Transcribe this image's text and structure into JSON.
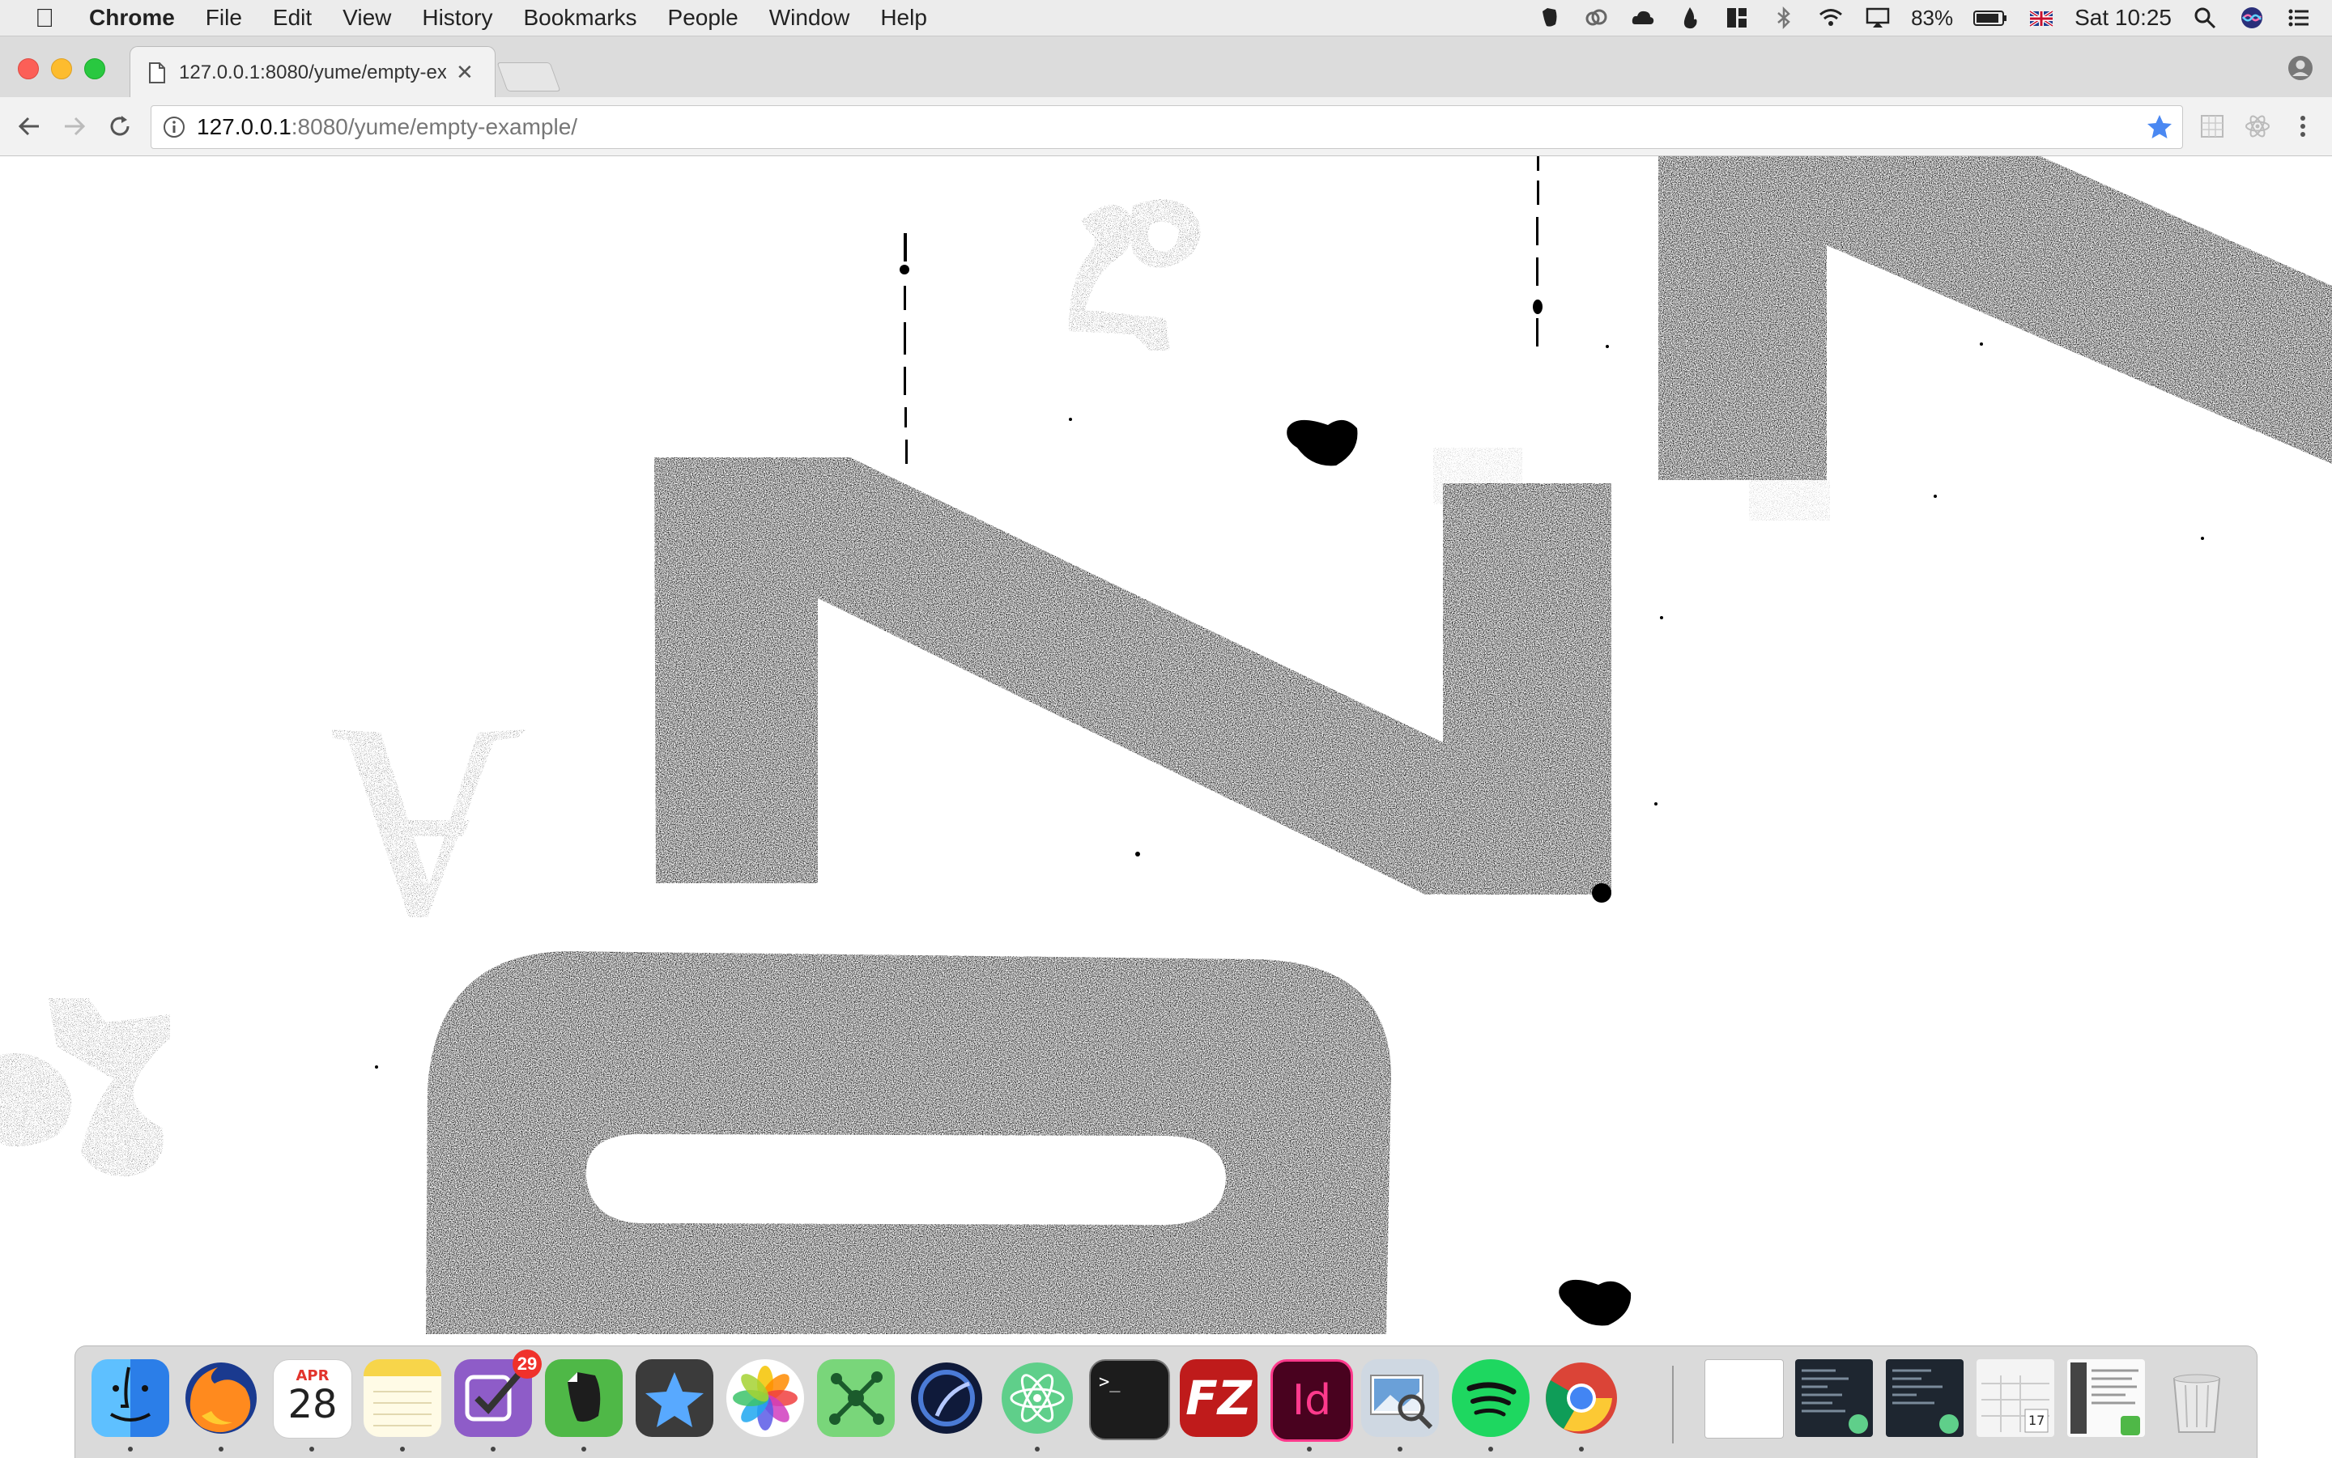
{
  "menubar": {
    "app_name": "Chrome",
    "menus": [
      "File",
      "Edit",
      "View",
      "History",
      "Bookmarks",
      "People",
      "Window",
      "Help"
    ],
    "battery_percent": "83%",
    "clock": "Sat 10:25"
  },
  "browser": {
    "tab_title": "127.0.0.1:8080/yume/empty-ex",
    "url_host": "127.0.0.1",
    "url_path": ":8080/yume/empty-example/"
  },
  "page": {
    "canvas_glyphs": [
      "A",
      "Z",
      "0",
      "2",
      "8"
    ]
  },
  "dock": {
    "apps": [
      {
        "name": "Finder",
        "icon": "finder-icon"
      },
      {
        "name": "Firefox",
        "icon": "firefox-icon"
      },
      {
        "name": "Calendar",
        "icon": "calendar-icon",
        "month": "APR",
        "day": "28"
      },
      {
        "name": "Notes",
        "icon": "notes-icon"
      },
      {
        "name": "OmniFocus",
        "icon": "omnifocus-icon",
        "badge": "29"
      },
      {
        "name": "Evernote",
        "icon": "evernote-icon"
      },
      {
        "name": "Xcode Instruments",
        "icon": "instruments-icon"
      },
      {
        "name": "Photos",
        "icon": "photos-icon"
      },
      {
        "name": "Mindnode",
        "icon": "mindnode-icon"
      },
      {
        "name": "Cinema 4D",
        "icon": "cinema4d-icon"
      },
      {
        "name": "Atom",
        "icon": "atom-icon"
      },
      {
        "name": "Terminal",
        "icon": "terminal-icon",
        "prompt": ">_"
      },
      {
        "name": "FileZilla",
        "icon": "filezilla-icon",
        "glyph": "FZ"
      },
      {
        "name": "InDesign",
        "icon": "indesign-icon",
        "glyph": "Id"
      },
      {
        "name": "Preview",
        "icon": "preview-icon"
      },
      {
        "name": "Spotify",
        "icon": "spotify-icon"
      },
      {
        "name": "Chrome",
        "icon": "chrome-icon"
      }
    ],
    "calendar_mini_day": "17"
  }
}
